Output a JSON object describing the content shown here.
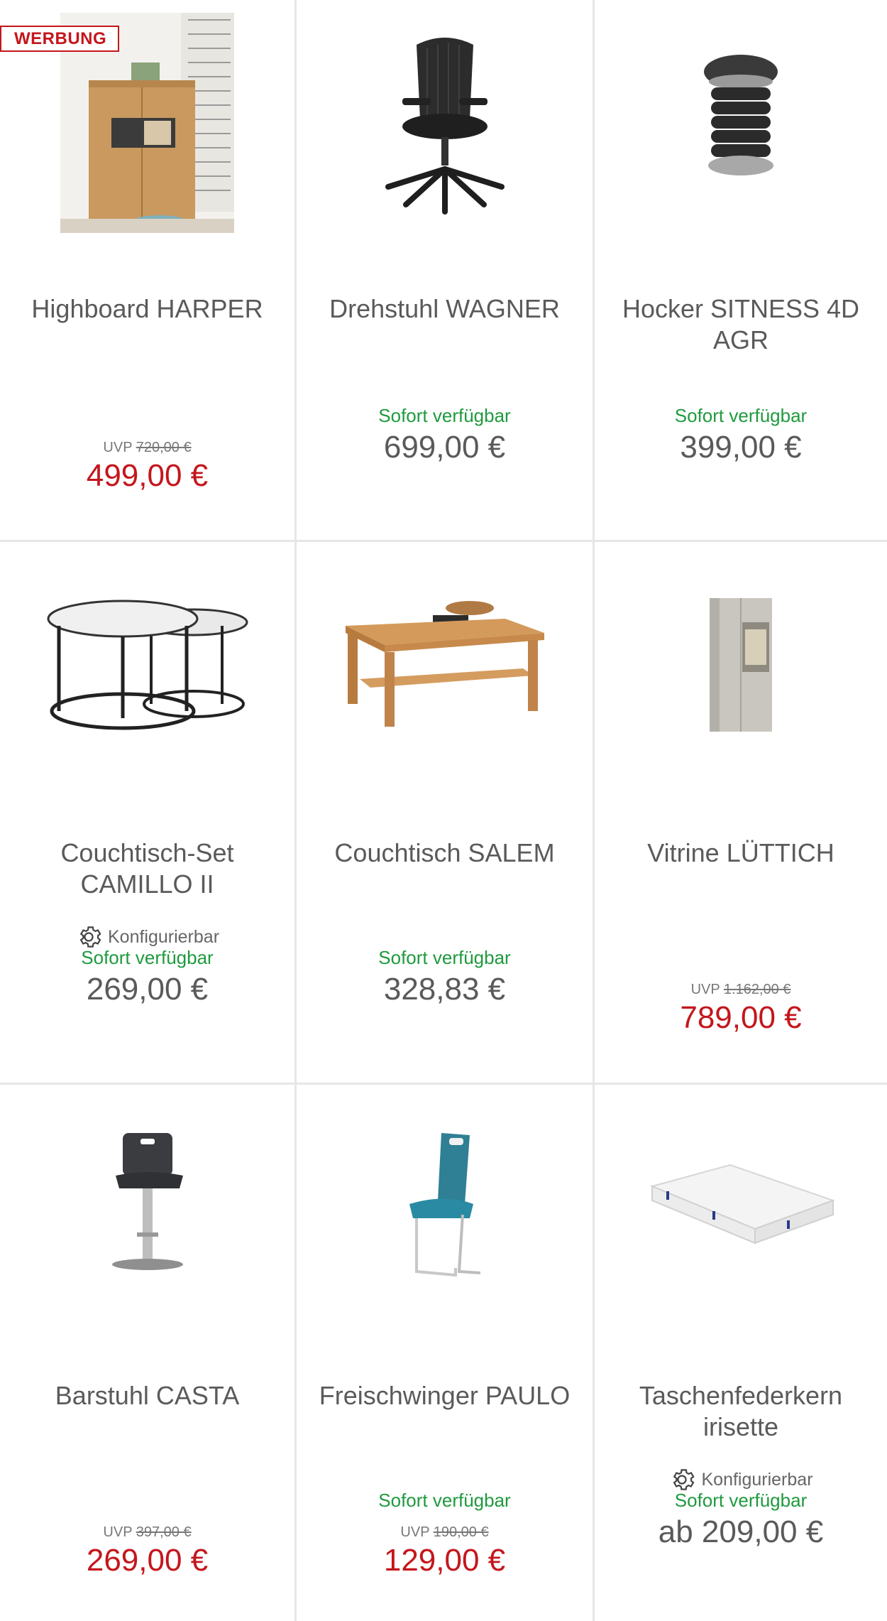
{
  "ad_label": "WERBUNG",
  "uvp_prefix": "UVP",
  "configurable_label": "Konfigurierbar",
  "colors": {
    "sale": "#c4161c",
    "available": "#1f9a3e",
    "text": "#5a5a5a",
    "border": "#e6e6e6"
  },
  "products": [
    {
      "title": "Highboard HARPER",
      "uvp_price": "720,00 €",
      "price": "499,00 €",
      "image": "highboard-image"
    },
    {
      "title": "Drehstuhl WAGNER",
      "availability": "Sofort verfügbar",
      "price": "699,00 €",
      "image": "office-chair-image"
    },
    {
      "title": "Hocker SITNESS 4D AGR",
      "availability": "Sofort verfügbar",
      "price": "399,00 €",
      "image": "stool-image"
    },
    {
      "title": "Couchtisch-Set CAMILLO II",
      "availability": "Sofort verfügbar",
      "price": "269,00 €",
      "image": "nesting-tables-image"
    },
    {
      "title": "Couchtisch SALEM",
      "availability": "Sofort verfügbar",
      "price": "328,83 €",
      "image": "coffee-table-image"
    },
    {
      "title": "Vitrine LÜTTICH",
      "uvp_price": "1.162,00 €",
      "price": "789,00 €",
      "image": "vitrine-image"
    },
    {
      "title": "Barstuhl CASTA",
      "uvp_price": "397,00 €",
      "price": "269,00 €",
      "image": "bar-stool-image"
    },
    {
      "title": "Freischwinger PAULO",
      "availability": "Sofort verfügbar",
      "uvp_price": "190,00 €",
      "price": "129,00 €",
      "image": "cantilever-chair-image"
    },
    {
      "title": "Taschenfederkern irisette",
      "availability": "Sofort verfügbar",
      "price": "ab 209,00 €",
      "image": "mattress-image"
    }
  ]
}
